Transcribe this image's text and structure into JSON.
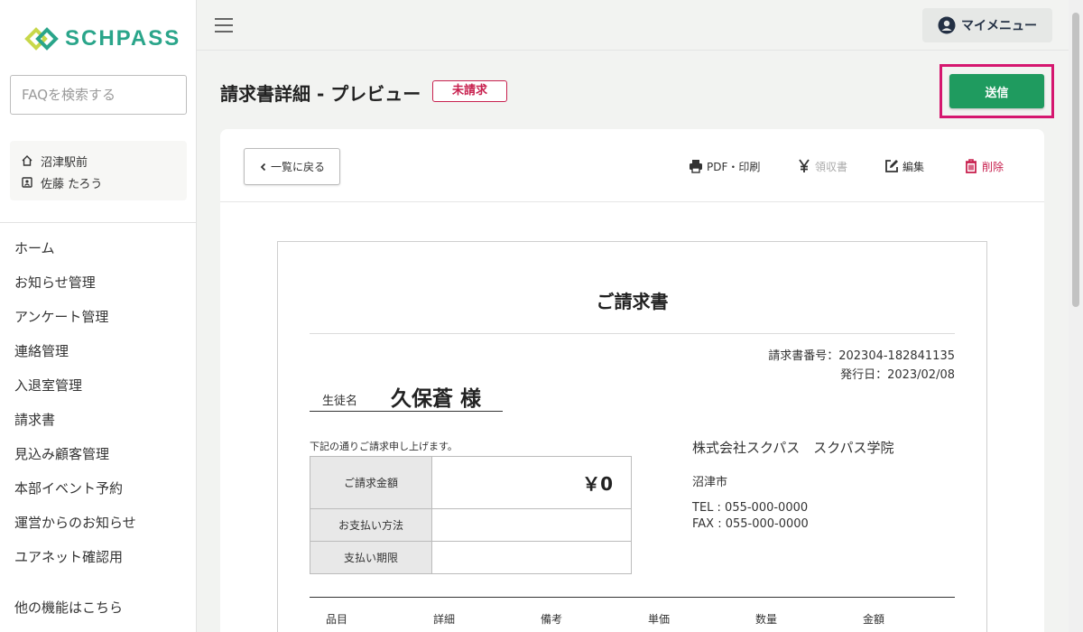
{
  "app": {
    "name": "SCHPASS"
  },
  "sidebar": {
    "faq_placeholder": "FAQを検索する",
    "school": "沼津駅前",
    "user": "佐藤 たろう",
    "items": [
      {
        "label": "ホーム"
      },
      {
        "label": "お知らせ管理"
      },
      {
        "label": "アンケート管理"
      },
      {
        "label": "連絡管理"
      },
      {
        "label": "入退室管理"
      },
      {
        "label": "請求書"
      },
      {
        "label": "見込み顧客管理"
      },
      {
        "label": "本部イベント予約"
      },
      {
        "label": "運営からのお知らせ"
      },
      {
        "label": "ユアネット確認用"
      }
    ],
    "more": "他の機能はこちら"
  },
  "header": {
    "mymenu_label": "マイメニュー"
  },
  "page": {
    "title": "請求書詳細 - プレビュー",
    "status": "未請求",
    "send_label": "送信"
  },
  "toolbar": {
    "back_label": "一覧に戻る",
    "pdf_label": "PDF・印刷",
    "receipt_label": "領収書",
    "edit_label": "編集",
    "delete_label": "削除"
  },
  "invoice": {
    "title": "ご請求書",
    "number": "請求書番号：202304-182841135",
    "issue_date": "発行日：2023/02/08",
    "student_label": "生徒名",
    "student_name": "久保蒼 様",
    "notice": "下記の通りご請求申し上げます。",
    "rows": [
      {
        "label": "ご請求金額",
        "value": "￥0"
      },
      {
        "label": "お支払い方法",
        "value": ""
      },
      {
        "label": "支払い期限",
        "value": ""
      }
    ],
    "company": "株式会社スクパス　スクパス学院",
    "city": "沼津市",
    "tel": "TEL : 055-000-0000",
    "fax": "FAX : 055-000-0000",
    "columns": [
      "品目",
      "詳細",
      "備考",
      "単価",
      "数量",
      "金額"
    ]
  },
  "colors": {
    "brand": "#2aa58a",
    "send": "#1f9b5f",
    "alert": "#c8214f",
    "highlight": "#d5176f"
  }
}
